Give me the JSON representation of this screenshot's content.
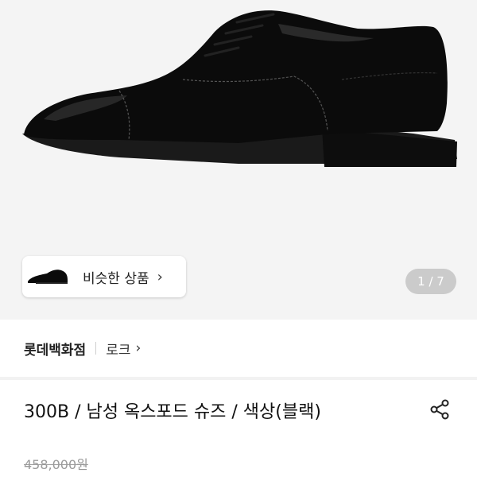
{
  "hero": {
    "similar_label": "비슷한 상품",
    "similar_chevron": "›",
    "page_indicator": "1 / 7"
  },
  "brand": {
    "name": "롯데백화점",
    "sub": "로크",
    "sub_chevron": "›"
  },
  "product": {
    "title": "300B / 남성 옥스포드 슈즈 / 색상(블랙)",
    "original_price": "458,000원"
  },
  "icons": {
    "share": "share-icon",
    "chevron": "chevron-right-icon"
  }
}
